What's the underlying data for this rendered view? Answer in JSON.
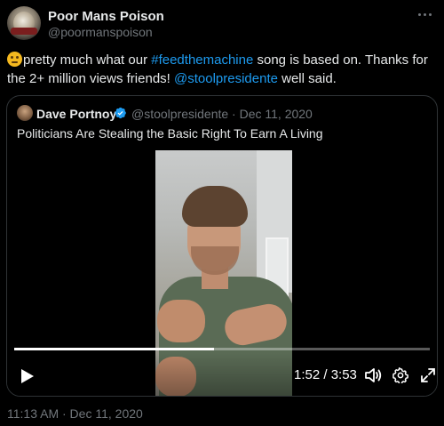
{
  "author": {
    "name": "Poor Mans Poison",
    "handle": "@poormanspoison"
  },
  "tweet": {
    "emoji": "thinking-face",
    "text_pre": "pretty much what our ",
    "hashtag": "#feedthemachine",
    "text_mid": " song is based on. Thanks for the 2+ million views friends! ",
    "mention": "@stoolpresidente",
    "text_post": " well said."
  },
  "quote": {
    "name": "Dave Portnoy",
    "verified": true,
    "meta": "@stoolpresidente · Dec 11, 2020",
    "text": "Politicians Are Stealing the Basic Right To Earn A Living"
  },
  "video": {
    "time": "1:52 / 3:53",
    "progress": 0.4807
  },
  "timestamp": "11:13 AM · Dec 11, 2020",
  "colors": {
    "background": "#000000",
    "text": "#e7e9ea",
    "secondary": "#71767b",
    "link": "#1d9bf0",
    "border": "#2f3336"
  },
  "icons": {
    "more": "more-horizontal-icon",
    "verified": "verified-badge-icon",
    "play": "play-icon",
    "volume": "volume-icon",
    "settings": "gear-icon",
    "expand": "expand-icon"
  }
}
